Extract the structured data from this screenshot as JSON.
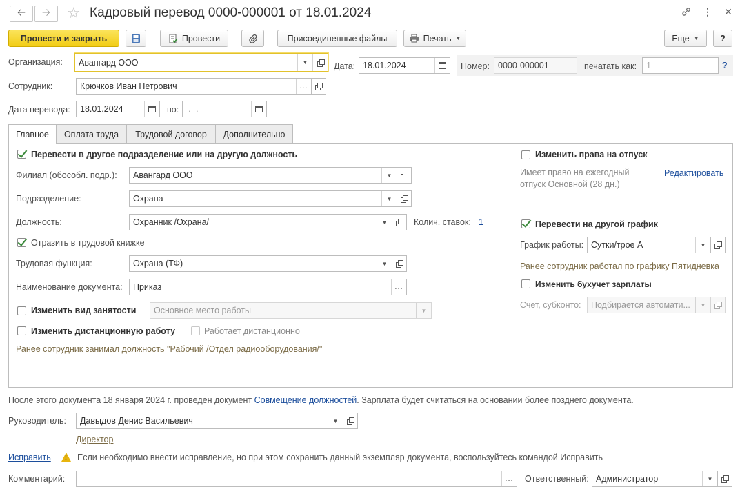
{
  "header": {
    "title": "Кадровый перевод 0000-000001 от 18.01.2024",
    "back_icon": "arrow-left-icon",
    "forward_icon": "arrow-right-icon"
  },
  "toolbar": {
    "post_close": "Провести и закрыть",
    "post": "Провести",
    "attached_files": "Присоединенные файлы",
    "print": "Печать",
    "more": "Еще",
    "help": "?"
  },
  "form": {
    "org_label": "Организация:",
    "org_value": "Авангард ООО",
    "date_label": "Дата:",
    "date_value": "18.01.2024",
    "number_label": "Номер:",
    "number_value": "0000-000001",
    "print_as_label": "печатать как:",
    "print_as_placeholder": "1",
    "help_mark": "?",
    "employee_label": "Сотрудник:",
    "employee_value": "Крючков Иван Петрович",
    "transfer_date_label": "Дата перевода:",
    "transfer_date_value": "18.01.2024",
    "to_label": "по:",
    "to_value": " .  ."
  },
  "tabs": [
    "Главное",
    "Оплата труда",
    "Трудовой договор",
    "Дополнительно"
  ],
  "main": {
    "transfer_cb": "Перевести в другое подразделение или на другую должность",
    "branch_label": "Филиал (обособл. подр.):",
    "branch_value": "Авангард ООО",
    "dept_label": "Подразделение:",
    "dept_value": "Охрана",
    "position_label": "Должность:",
    "position_value": "Охранник /Охрана/",
    "rates_label": "Колич. ставок:",
    "rates_value": "1",
    "workbook_cb": "Отразить в трудовой книжке",
    "func_label": "Трудовая функция:",
    "func_value": "Охрана (ТФ)",
    "docname_label": "Наименование документа:",
    "docname_value": "Приказ",
    "employment_cb": "Изменить вид занятости",
    "employment_value": "Основное место работы",
    "remote_cb": "Изменить дистанционную работу",
    "remote_sub_cb": "Работает дистанционно",
    "prev_position_note": "Ранее сотрудник занимал должность \"Рабочий /Отдел радиооборудования/\"",
    "vacation_cb": "Изменить права на отпуск",
    "vacation_note_1": "Имеет право на ежегодный",
    "vacation_note_2": "отпуск Основной (28 дн.)",
    "edit_link": "Редактировать",
    "schedule_cb": "Перевести на другой график",
    "schedule_label": "График работы:",
    "schedule_value": "Сутки/трое А",
    "prev_schedule_note": "Ранее сотрудник работал по графику Пятидневка",
    "accounting_cb": "Изменить бухучет зарплаты",
    "account_label": "Счет, субконто:",
    "account_value": "Подбирается автомати..."
  },
  "footer": {
    "after_note_prefix": "После этого документа 18 января 2024 г. проведен документ",
    "after_note_link": "Совмещение должностей",
    "after_note_suffix": ". Зарплата будет считаться на основании более позднего документа.",
    "manager_label": "Руководитель:",
    "manager_value": "Давыдов Денис Васильевич",
    "manager_position": "Директор",
    "fix_link": "Исправить",
    "fix_note": "Если необходимо внести исправление, но при этом сохранить данный экземпляр документа, воспользуйтесь командой Исправить",
    "comment_label": "Комментарий:",
    "comment_value": "",
    "responsible_label": "Ответственный:",
    "responsible_value": "Администратор"
  }
}
